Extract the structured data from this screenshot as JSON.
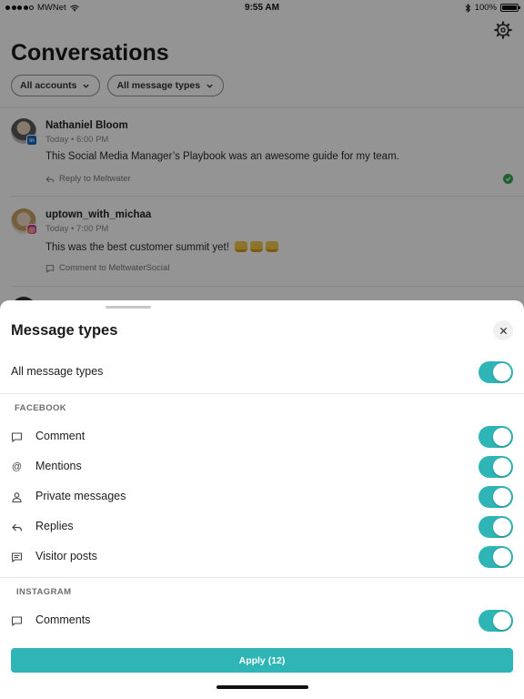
{
  "status_bar": {
    "carrier": "MWNet",
    "time": "9:55 AM",
    "battery": "100%"
  },
  "page": {
    "title": "Conversations"
  },
  "filters": {
    "accounts": "All accounts",
    "message_types": "All message types"
  },
  "conversations": [
    {
      "author": "Nathaniel Bloom",
      "meta": "Today • 6:00 PM",
      "network": "linkedin",
      "network_badge": "in",
      "text": "This Social Media Manager’s Playbook was an awesome guide for my team.",
      "action": "Reply to Meltwater"
    },
    {
      "author": "uptown_with_michaa",
      "meta": "Today • 7:00 PM",
      "network": "instagram",
      "text": "This was the best customer summit yet!",
      "action": "Comment to MeltwaterSocial"
    }
  ],
  "sheet": {
    "title": "Message types",
    "all_label": "All message types",
    "all_enabled": true,
    "sections": [
      {
        "header": "FACEBOOK",
        "items": [
          {
            "label": "Comment",
            "icon": "comment-icon",
            "enabled": true
          },
          {
            "label": "Mentions",
            "icon": "at-icon",
            "enabled": true
          },
          {
            "label": "Private messages",
            "icon": "person-icon",
            "enabled": true
          },
          {
            "label": "Replies",
            "icon": "reply-icon",
            "enabled": true
          },
          {
            "label": "Visitor posts",
            "icon": "post-icon",
            "enabled": true
          }
        ]
      },
      {
        "header": "INSTAGRAM",
        "items": [
          {
            "label": "Comments",
            "icon": "comment-icon",
            "enabled": true
          }
        ]
      }
    ],
    "apply_label": "Apply (12)"
  },
  "colors": {
    "accent": "#2fb5b5",
    "success": "#33a853",
    "linkedin": "#0a66c2"
  }
}
